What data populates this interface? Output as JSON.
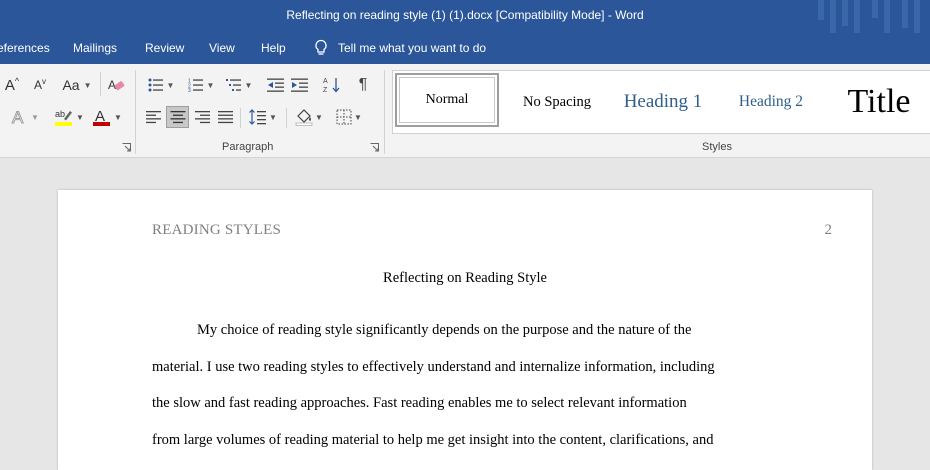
{
  "window": {
    "title": "Reflecting on reading style (1) (1).docx [Compatibility Mode]  -  Word"
  },
  "tabs": [
    "eferences",
    "Mailings",
    "Review",
    "View",
    "Help"
  ],
  "tell_me": "Tell me what you want to do",
  "ribbon": {
    "groups": {
      "paragraph": "Paragraph",
      "styles": "Styles"
    },
    "font": {
      "grow_label": "A",
      "shrink_label": "A",
      "case_label": "Aa",
      "highlight_color": "#ffff00",
      "font_color": "#c00000"
    },
    "styles": [
      {
        "name": "Normal"
      },
      {
        "name": "No Spacing"
      },
      {
        "name": "Heading 1"
      },
      {
        "name": "Heading 2"
      },
      {
        "name": "Title"
      }
    ]
  },
  "colors": {
    "brand": "#2b579a",
    "heading": "#2e5f8a"
  },
  "document": {
    "running_head": "READING STYLES",
    "page_number": "2",
    "title": "Reflecting on Reading Style",
    "lines": [
      "My choice of reading style significantly depends on the purpose and the nature of the",
      "material. I use two reading styles to effectively understand and internalize information, including",
      "the slow and fast reading approaches. Fast reading enables me to select relevant information",
      "from large volumes of reading material to help me get insight into the content, clarifications, and"
    ]
  }
}
